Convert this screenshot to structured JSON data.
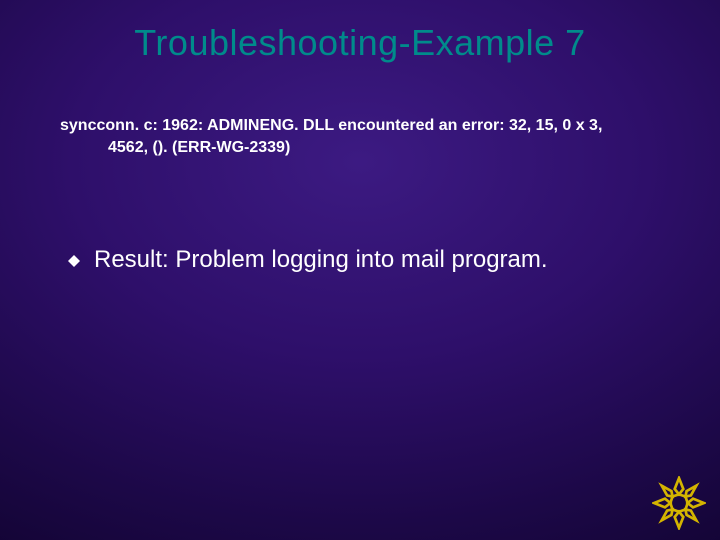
{
  "title": "Troubleshooting-Example 7",
  "error": {
    "line1": "syncconn. c: 1962: ADMINENG. DLL encountered an error: 32, 15, 0 x 3,",
    "line2": "4562, (). (ERR-WG-2339)"
  },
  "bullet": {
    "text": "Result: Problem logging into mail program."
  }
}
